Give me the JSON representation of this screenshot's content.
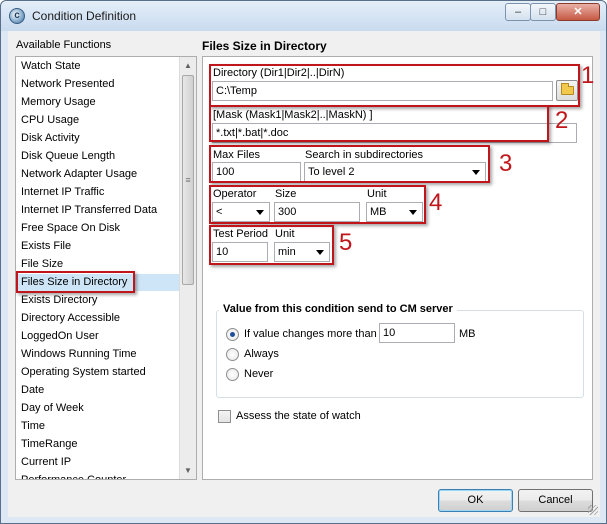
{
  "window": {
    "title": "Condition Definition",
    "controls": {
      "minimize": "–",
      "maximize": "□",
      "close": "✕"
    }
  },
  "left": {
    "title": "Available Functions",
    "items": [
      "Watch State",
      "Network Presented",
      "Memory Usage",
      "CPU Usage",
      "Disk Activity",
      "Disk Queue Length",
      "Network Adapter Usage",
      "Internet IP Traffic",
      "Internet IP Transferred Data",
      "Free Space On Disk",
      "Exists File",
      "File Size",
      "Files Size in Directory",
      "Exists Directory",
      "Directory Accessible",
      "LoggedOn User",
      "Windows Running Time",
      "Operating System started",
      "Date",
      "Day of Week",
      "Time",
      "TimeRange",
      "Current IP",
      "Performance Counter"
    ],
    "selected_item": "Files Size in Directory",
    "scroll_up": "▲",
    "scroll_down": "▼",
    "scroll_grip": "≡"
  },
  "right": {
    "title": "Files Size in Directory",
    "directory": {
      "label": "Directory (Dir1|Dir2|..|DirN)",
      "value": "C:\\Temp"
    },
    "mask": {
      "label": "[Mask (Mask1|Mask2|..|MaskN) ]",
      "value": "*.txt|*.bat|*.doc"
    },
    "max_files": {
      "label": "Max Files",
      "value": "100"
    },
    "search": {
      "label": "Search in subdirectories",
      "value": "To level 2"
    },
    "operator": {
      "label": "Operator",
      "value": "<"
    },
    "size": {
      "label": "Size",
      "value": "300"
    },
    "unit": {
      "label": "Unit",
      "value": "MB"
    },
    "test_period": {
      "label": "Test Period",
      "value": "10"
    },
    "period_unit": {
      "label": "Unit",
      "value": "min"
    },
    "send_group": {
      "title": "Value from this condition send to CM server",
      "option_changes": "If value changes more than",
      "change_value": "10",
      "change_unit": "MB",
      "option_always": "Always",
      "option_never": "Never",
      "selected": "If value changes more than"
    },
    "assess_label": "Assess the state of watch",
    "assess_checked": false
  },
  "annotations": [
    "1",
    "2",
    "3",
    "4",
    "5"
  ],
  "annotation_color": "#c0161b",
  "buttons": {
    "ok": "OK",
    "cancel": "Cancel"
  }
}
